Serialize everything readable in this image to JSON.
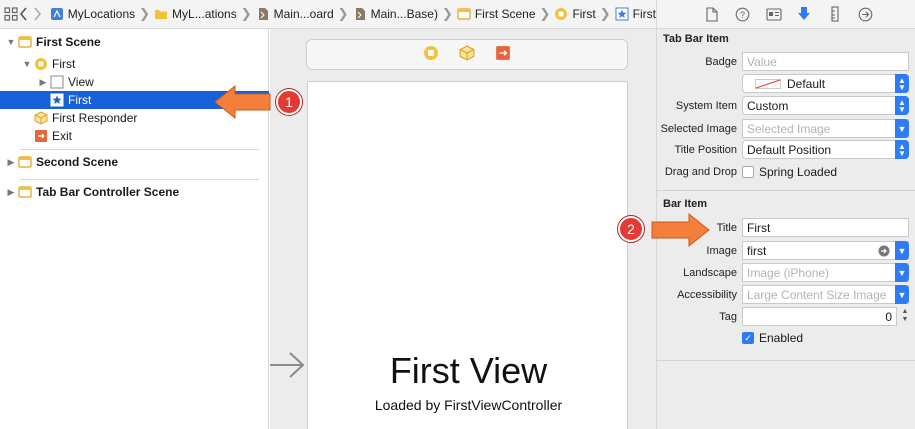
{
  "jumpbar": {
    "crumbs": [
      {
        "label": "MyLocations",
        "icon": "project-icon"
      },
      {
        "label": "MyL...ations",
        "icon": "folder-icon"
      },
      {
        "label": "Main...oard",
        "icon": "storyboard-file-icon"
      },
      {
        "label": "Main...Base)",
        "icon": "storyboard-file-icon"
      },
      {
        "label": "First Scene",
        "icon": "scene-icon"
      },
      {
        "label": "First",
        "icon": "view-controller-icon"
      },
      {
        "label": "First",
        "icon": "tab-bar-item-star-icon"
      }
    ]
  },
  "outline": {
    "first_scene": "First Scene",
    "first_vc": "First",
    "view": "View",
    "first_item": "First",
    "first_responder": "First Responder",
    "exit": "Exit",
    "second_scene": "Second Scene",
    "tab_bar_scene": "Tab Bar Controller Scene"
  },
  "canvas": {
    "title": "First View",
    "subtitle": "Loaded by FirstViewController"
  },
  "callouts": {
    "one": "1",
    "two": "2"
  },
  "inspector": {
    "tab_bar_item": {
      "section": "Tab Bar Item",
      "badge_label": "Badge",
      "badge_placeholder": "Value",
      "badge_color": "Default",
      "system_item_label": "System Item",
      "system_item_value": "Custom",
      "selected_image_label": "Selected Image",
      "selected_image_placeholder": "Selected Image",
      "title_position_label": "Title Position",
      "title_position_value": "Default Position",
      "drag_drop_label": "Drag and Drop",
      "spring_loaded": "Spring Loaded"
    },
    "bar_item": {
      "section": "Bar Item",
      "title_label": "Title",
      "title_value": "First",
      "image_label": "Image",
      "image_value": "first",
      "landscape_label": "Landscape",
      "landscape_placeholder": "Image (iPhone)",
      "accessibility_label": "Accessibility",
      "accessibility_placeholder": "Large Content Size Image",
      "tag_label": "Tag",
      "tag_value": "0",
      "enabled_label": "Enabled"
    }
  },
  "colors": {
    "selection": "#1760d8",
    "accent": "#2d7cf6",
    "callout_arrow": "#f47f3a",
    "callout_badge": "#e53935",
    "scene_icon": "#f0b429"
  }
}
